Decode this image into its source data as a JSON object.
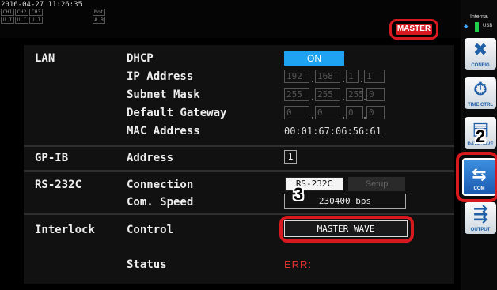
{
  "status_bar": {
    "timestamp": "2016-04-27 11:26:35",
    "channel_row1": [
      "CH1",
      "CH2",
      "CH3"
    ],
    "channel_row2": [
      "U I",
      "U I",
      "U I"
    ],
    "mot": "Mot",
    "mot_ab": "A B",
    "master_label": "MASTER"
  },
  "storage": {
    "internal": "Internal",
    "usb": "USB"
  },
  "sidebar": {
    "config": "CONFIG",
    "time_ctrl": "TIME CTRL",
    "data_save": "DATA SAVE",
    "com": "COM",
    "output": "OUTPUT"
  },
  "lan": {
    "category": "LAN",
    "dhcp_label": "DHCP",
    "dhcp_value": "ON",
    "ip_label": "IP Address",
    "ip": [
      "192",
      "168",
      "1",
      "1"
    ],
    "mask_label": "Subnet Mask",
    "mask": [
      "255",
      "255",
      "255",
      "0"
    ],
    "gateway_label": "Default Gateway",
    "gateway": [
      "0",
      "0",
      "0",
      "0"
    ],
    "mac_label": "MAC Address",
    "mac": "00:01:67:06:56:61"
  },
  "gpib": {
    "category": "GP-IB",
    "address_label": "Address",
    "address": "1"
  },
  "rs232c": {
    "category": "RS-232C",
    "connection_label": "Connection",
    "connection_value": "RS-232C",
    "setup_label": "Setup",
    "speed_label": "Com. Speed",
    "speed_value": "230400 bps"
  },
  "interlock": {
    "category": "Interlock",
    "control_label": "Control",
    "control_value": "MASTER WAVE",
    "status_label": "Status",
    "status_value": "ERR:"
  },
  "steps": {
    "two": "2",
    "three": "3"
  },
  "colors": {
    "highlight": "#d71920",
    "on": "#1ea3f2",
    "error": "#e0322d"
  }
}
